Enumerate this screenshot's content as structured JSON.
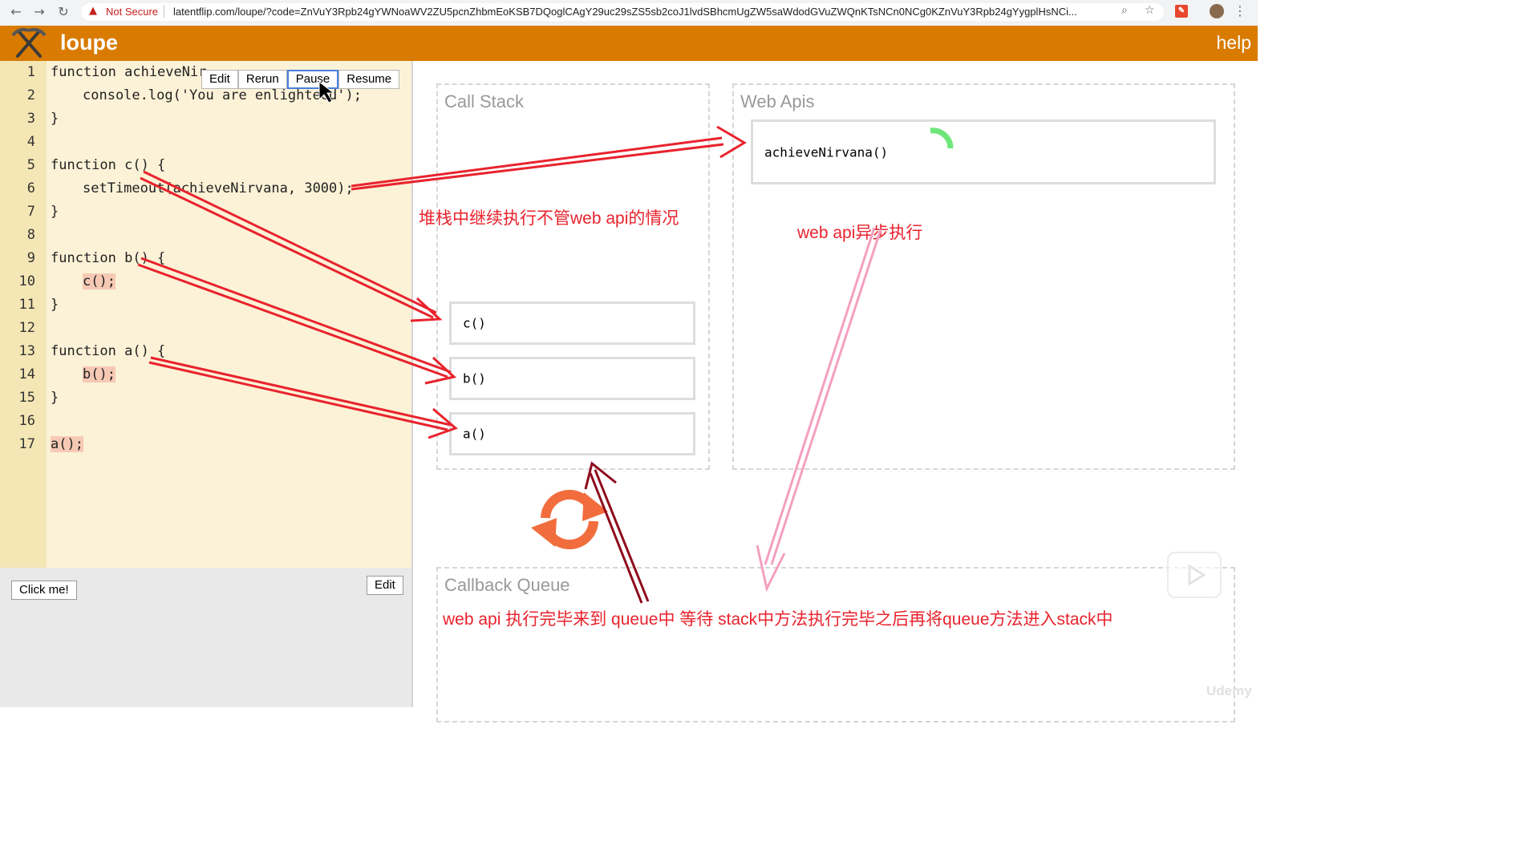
{
  "browser": {
    "security_label": "Not Secure",
    "url": "latentflip.com/loupe/?code=ZnVuY3Rpb24gYWNoaWV2ZU5pcnZhbmEoKSB7DQoglCAgY29uc29sZS5sb2coJ1lvdSBhcmUgZW5saWdodGVuZWQnKTsNCn0NCg0KZnVuY3Rpb24gYygplHsNCi..."
  },
  "app": {
    "title": "loupe",
    "help": "help"
  },
  "editor": {
    "toolbar": [
      "Edit",
      "Rerun",
      "Pause",
      "Resume"
    ],
    "lines": [
      {
        "n": "1",
        "text": "function achieveNir",
        "indent": 0
      },
      {
        "n": "2",
        "text": "console.log('You are enlighte",
        "text2": "ed');",
        "indent": 1
      },
      {
        "n": "3",
        "text": "}",
        "indent": 0
      },
      {
        "n": "4",
        "text": "",
        "indent": 0
      },
      {
        "n": "5",
        "text": "function c() {",
        "indent": 0
      },
      {
        "n": "6",
        "text": "setTimeout(achieveNirvana, 3000);",
        "indent": 1
      },
      {
        "n": "7",
        "text": "}",
        "indent": 0
      },
      {
        "n": "8",
        "text": "",
        "indent": 0
      },
      {
        "n": "9",
        "text": "function b() {",
        "indent": 0
      },
      {
        "n": "10",
        "text": "c();",
        "indent": 1,
        "highlight": true
      },
      {
        "n": "11",
        "text": "}",
        "indent": 0
      },
      {
        "n": "12",
        "text": "",
        "indent": 0
      },
      {
        "n": "13",
        "text": "function a() {",
        "indent": 0
      },
      {
        "n": "14",
        "text": "b();",
        "indent": 1,
        "highlight": true
      },
      {
        "n": "15",
        "text": "}",
        "indent": 0
      },
      {
        "n": "16",
        "text": "",
        "indent": 0
      },
      {
        "n": "17",
        "text": "a();",
        "indent": 0,
        "highlight": true
      }
    ]
  },
  "html_panel": {
    "click_me": "Click me!",
    "edit": "Edit"
  },
  "call_stack": {
    "title": "Call Stack",
    "frames": [
      "c()",
      "b()",
      "a()"
    ]
  },
  "web_apis": {
    "title": "Web Apis",
    "items": [
      "achieveNirvana()"
    ]
  },
  "callback_queue": {
    "title": "Callback Queue"
  },
  "annotations": {
    "stack_note": "堆栈中继续执行不管web api的情况",
    "webapi_note": "web api异步执行",
    "queue_note": "web api 执行完毕来到 queue中 等待 stack中方法执行完毕之后再将queue方法进入stack中"
  },
  "watermark": "Udemy",
  "colors": {
    "header": "#d97b00",
    "annotation": "#e8232d",
    "editor_bg": "#fcf2d7",
    "loop_icon": "#f26d3d"
  }
}
